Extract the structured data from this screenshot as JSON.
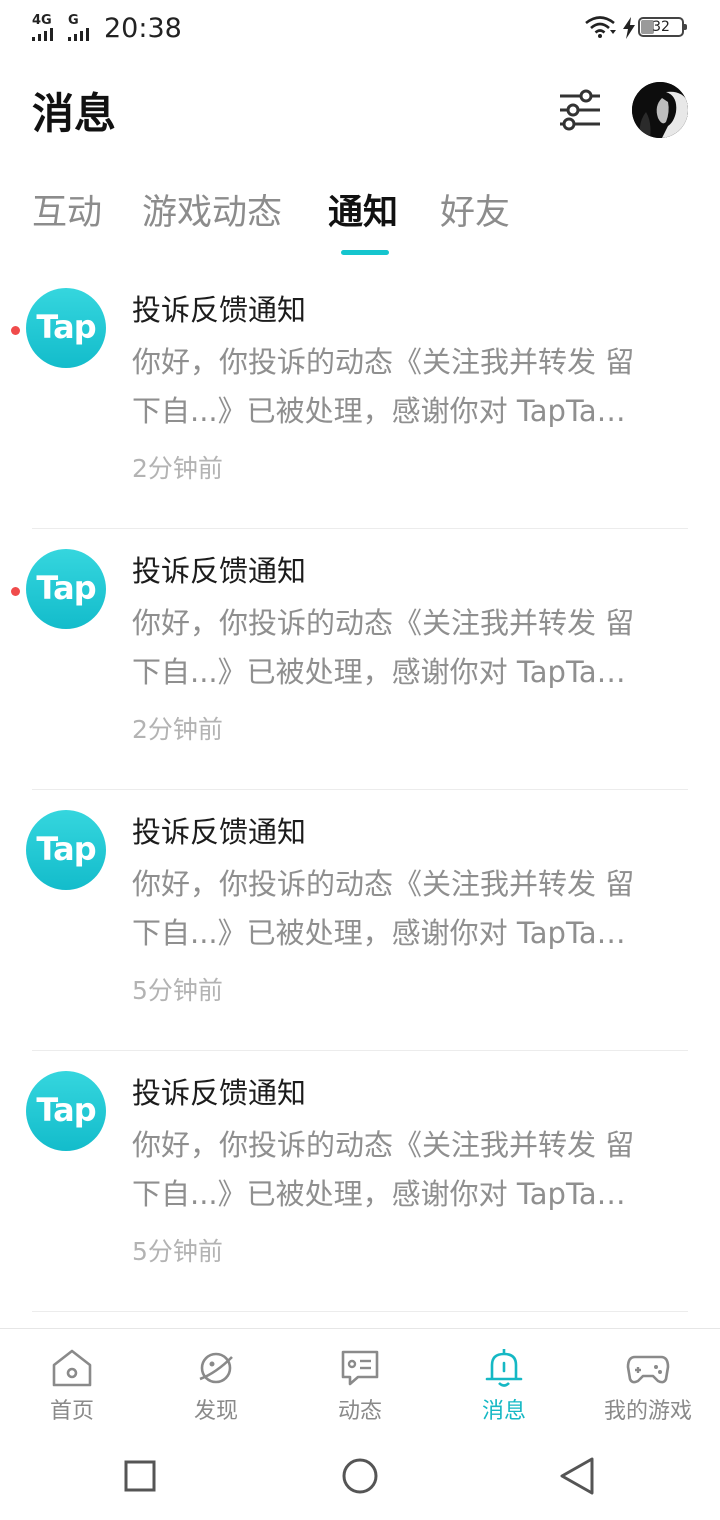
{
  "status_bar": {
    "network_1": "4G",
    "network_2": "G",
    "time": "20:38",
    "battery": "32",
    "icons": [
      "signal-icon",
      "wifi-icon",
      "charging-icon",
      "battery-icon"
    ]
  },
  "header": {
    "title": "消息",
    "filter_icon": "filter-sliders-icon",
    "avatar": "user-avatar"
  },
  "tabs": [
    {
      "label": "互动",
      "active": false
    },
    {
      "label": "游戏动态",
      "active": false
    },
    {
      "label": "通知",
      "active": true
    },
    {
      "label": "好友",
      "active": false
    }
  ],
  "notifications": [
    {
      "logo": "Tap",
      "unread": true,
      "title": "投诉反馈通知",
      "line1": "你好，你投诉的动态《关注我并转发 留",
      "line2": "下自...》已被处理，感谢你对 TapTa…",
      "time": "2分钟前"
    },
    {
      "logo": "Tap",
      "unread": true,
      "title": "投诉反馈通知",
      "line1": "你好，你投诉的动态《关注我并转发 留",
      "line2": "下自...》已被处理，感谢你对 TapTa…",
      "time": "2分钟前"
    },
    {
      "logo": "Tap",
      "unread": false,
      "title": "投诉反馈通知",
      "line1": "你好，你投诉的动态《关注我并转发 留",
      "line2": "下自...》已被处理，感谢你对 TapTa…",
      "time": "5分钟前"
    },
    {
      "logo": "Tap",
      "unread": false,
      "title": "投诉反馈通知",
      "line1": "你好，你投诉的动态《关注我并转发 留",
      "line2": "下自...》已被处理，感谢你对 TapTa…",
      "time": "5分钟前"
    }
  ],
  "bottom_nav": [
    {
      "label": "首页",
      "icon": "home-icon",
      "active": false
    },
    {
      "label": "发现",
      "icon": "planet-icon",
      "active": false
    },
    {
      "label": "动态",
      "icon": "chat-card-icon",
      "active": false
    },
    {
      "label": "消息",
      "icon": "bell-icon",
      "active": true
    },
    {
      "label": "我的游戏",
      "icon": "gamepad-icon",
      "active": false
    }
  ],
  "system_nav": [
    "recents-square-icon",
    "home-circle-icon",
    "back-triangle-icon"
  ],
  "colors": {
    "accent": "#15c5ce",
    "unread_dot": "#f04b4b",
    "tap_logo": "#1fc6d2"
  }
}
